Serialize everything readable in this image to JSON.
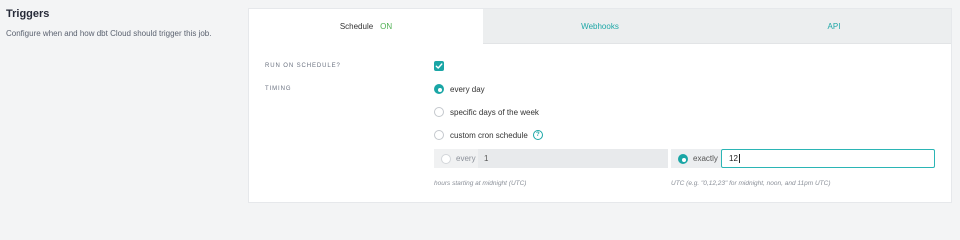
{
  "section": {
    "title": "Triggers",
    "description": "Configure when and how dbt Cloud should trigger this job."
  },
  "tabs": [
    {
      "label": "Schedule",
      "status": "ON"
    },
    {
      "label": "Webhooks"
    },
    {
      "label": "API"
    }
  ],
  "run_on_schedule": {
    "label": "RUN ON SCHEDULE?",
    "checked": true
  },
  "timing": {
    "label": "TIMING",
    "options": [
      {
        "label": "every day",
        "selected": true
      },
      {
        "label": "specific days of the week",
        "selected": false
      },
      {
        "label": "custom cron schedule",
        "selected": false
      }
    ],
    "help_icon": "question-circle-icon"
  },
  "interval": {
    "every_label": "every",
    "every_value": "1",
    "every_hint": "hours starting at midnight (UTC)",
    "exactly_label": "exactly",
    "exactly_value": "12",
    "exactly_hint": "UTC (e.g. \"0,12,23\" for midnight, noon, and 11pm UTC)"
  },
  "colors": {
    "accent": "#1aa6a6",
    "status_on": "#4caf50",
    "page_bg": "#f3f4f5"
  }
}
